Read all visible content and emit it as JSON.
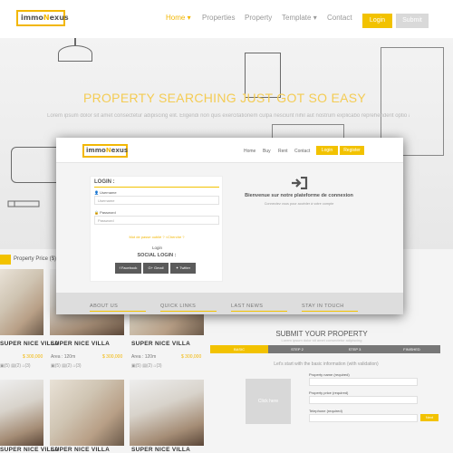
{
  "background_site": {
    "logo": {
      "prefix": "i",
      "mid": "mmo",
      "hl": "N",
      "suffix": "exus"
    },
    "nav": [
      "Home",
      "Properties",
      "Property",
      "Template"
    ],
    "nav_contact": "Contact",
    "nav_caret": "▾",
    "login": "Login",
    "submit": "Submit",
    "hero_title": "PROPERTY SEARCHING JUST GOT SO EASY",
    "hero_sub": "Lorem ipsum dolor sit amet consectetur adipiscing elit. Eligendi non quis exercitationem culpa nesciunt nihil aut nostrum explicabo reprehenderit optio amet ab temporibus asperiores quasi cupiditate. Voluptatum ducimus voluptates voluptas aliquam",
    "price_filter": "Property Price ($)"
  },
  "cards": [
    {
      "title": "SUPER NICE VILLA",
      "price": "",
      "area": ""
    },
    {
      "title": "SUPER NICE VILLA",
      "price": "$ 300,000",
      "area": "Area : 120m"
    },
    {
      "title": "SUPER NICE VILLA",
      "price": "$ 300,000",
      "area": "Area : 120m"
    },
    {
      "title": "SUPER NICE VILLA",
      "price": "",
      "area": ""
    },
    {
      "title": "SUPER NICE VILLA",
      "price": "",
      "area": ""
    },
    {
      "title": "SUPER NICE VILLA",
      "price": "",
      "area": ""
    }
  ],
  "card_icons": "▣(5) ▤(2) ⌂(3)",
  "submit": {
    "title": "SUBMIT YOUR PROPERTY",
    "subtitle": "Lorem ipsum dolor sit amet consectetur adipiscing",
    "steps": [
      "BASIC",
      "STEP 2",
      "STEP 3",
      "FINISHED"
    ],
    "info": "Let's start with the basic information (with validation)",
    "upload": "Click here",
    "labels": [
      "Property name (required)",
      "Property price (required)",
      "Telephone (required)"
    ],
    "next": "Next"
  },
  "modal": {
    "logo": {
      "prefix": "i",
      "mid": "mmo",
      "hl": "N",
      "suffix": "exus"
    },
    "menu": [
      "Home",
      "Buy",
      "Rent",
      "Contact"
    ],
    "login_btn": "Login",
    "register_btn": "Register",
    "login_title": "LOGIN :",
    "username_label": "Username",
    "username_placeholder": "Username",
    "password_label": "Password",
    "password_placeholder": "Password",
    "forgot": "Mot de passe oublié ? <Cherche ?",
    "login_action": "Login",
    "social_title": "SOCIAL LOGIN :",
    "social": [
      "Facebook",
      "Gmail",
      "Twitter"
    ],
    "welcome": "Bienvenue sur notre plateforme de connexion",
    "welcome_sub": "Connectez vous pour accéder à votre compte",
    "footer": [
      "ABOUT US",
      "QUICK LINKS",
      "LAST NEWS",
      "STAY IN TOUCH"
    ]
  },
  "colors": {
    "accent": "#f2c200",
    "dark": "#5b5b5b"
  }
}
